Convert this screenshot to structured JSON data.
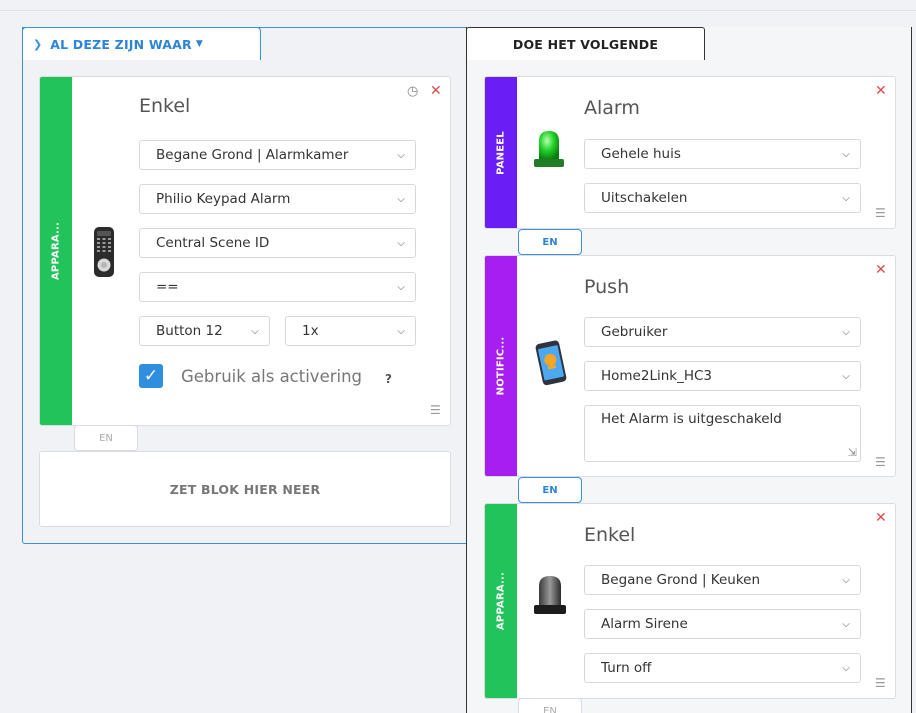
{
  "conditions": {
    "header_label": "AL DEZE ZIJN WAAR",
    "strip_label": "APPARA...",
    "title": "Enkel",
    "selects": [
      "Begane Grond | Alarmkamer",
      "Philio Keypad Alarm",
      "Central Scene ID",
      "=="
    ],
    "button_select": "Button 12",
    "count_select": "1x",
    "checkbox_label": "Gebruik als activering",
    "help": "?",
    "connector": "EN",
    "dropzone": "ZET BLOK HIER NEER"
  },
  "actions": {
    "header_label": "DOE HET VOLGENDE",
    "blocks": [
      {
        "strip": "PANEEL",
        "title": "Alarm",
        "fields": [
          "Gehele huis",
          "Uitschakelen"
        ],
        "icon": "siren-light-icon"
      },
      {
        "strip": "NOTIFIC...",
        "title": "Push",
        "fields": [
          "Gebruiker",
          "Home2Link_HC3"
        ],
        "message": "Het Alarm is uitgeschakeld",
        "icon": "push-notification-icon"
      },
      {
        "strip": "APPARA...",
        "title": "Enkel",
        "fields": [
          "Begane Grond | Keuken",
          "Alarm Sirene",
          "Turn off"
        ],
        "icon": "siren-device-icon"
      }
    ],
    "connectors": [
      "EN",
      "EN",
      "EN"
    ]
  },
  "colors": {
    "accent": "#2d84d6",
    "device_strip": "#22c35a",
    "panel_strip": "#6a1df5",
    "notification_strip": "#a61ef0",
    "close": "#e04b4b"
  }
}
